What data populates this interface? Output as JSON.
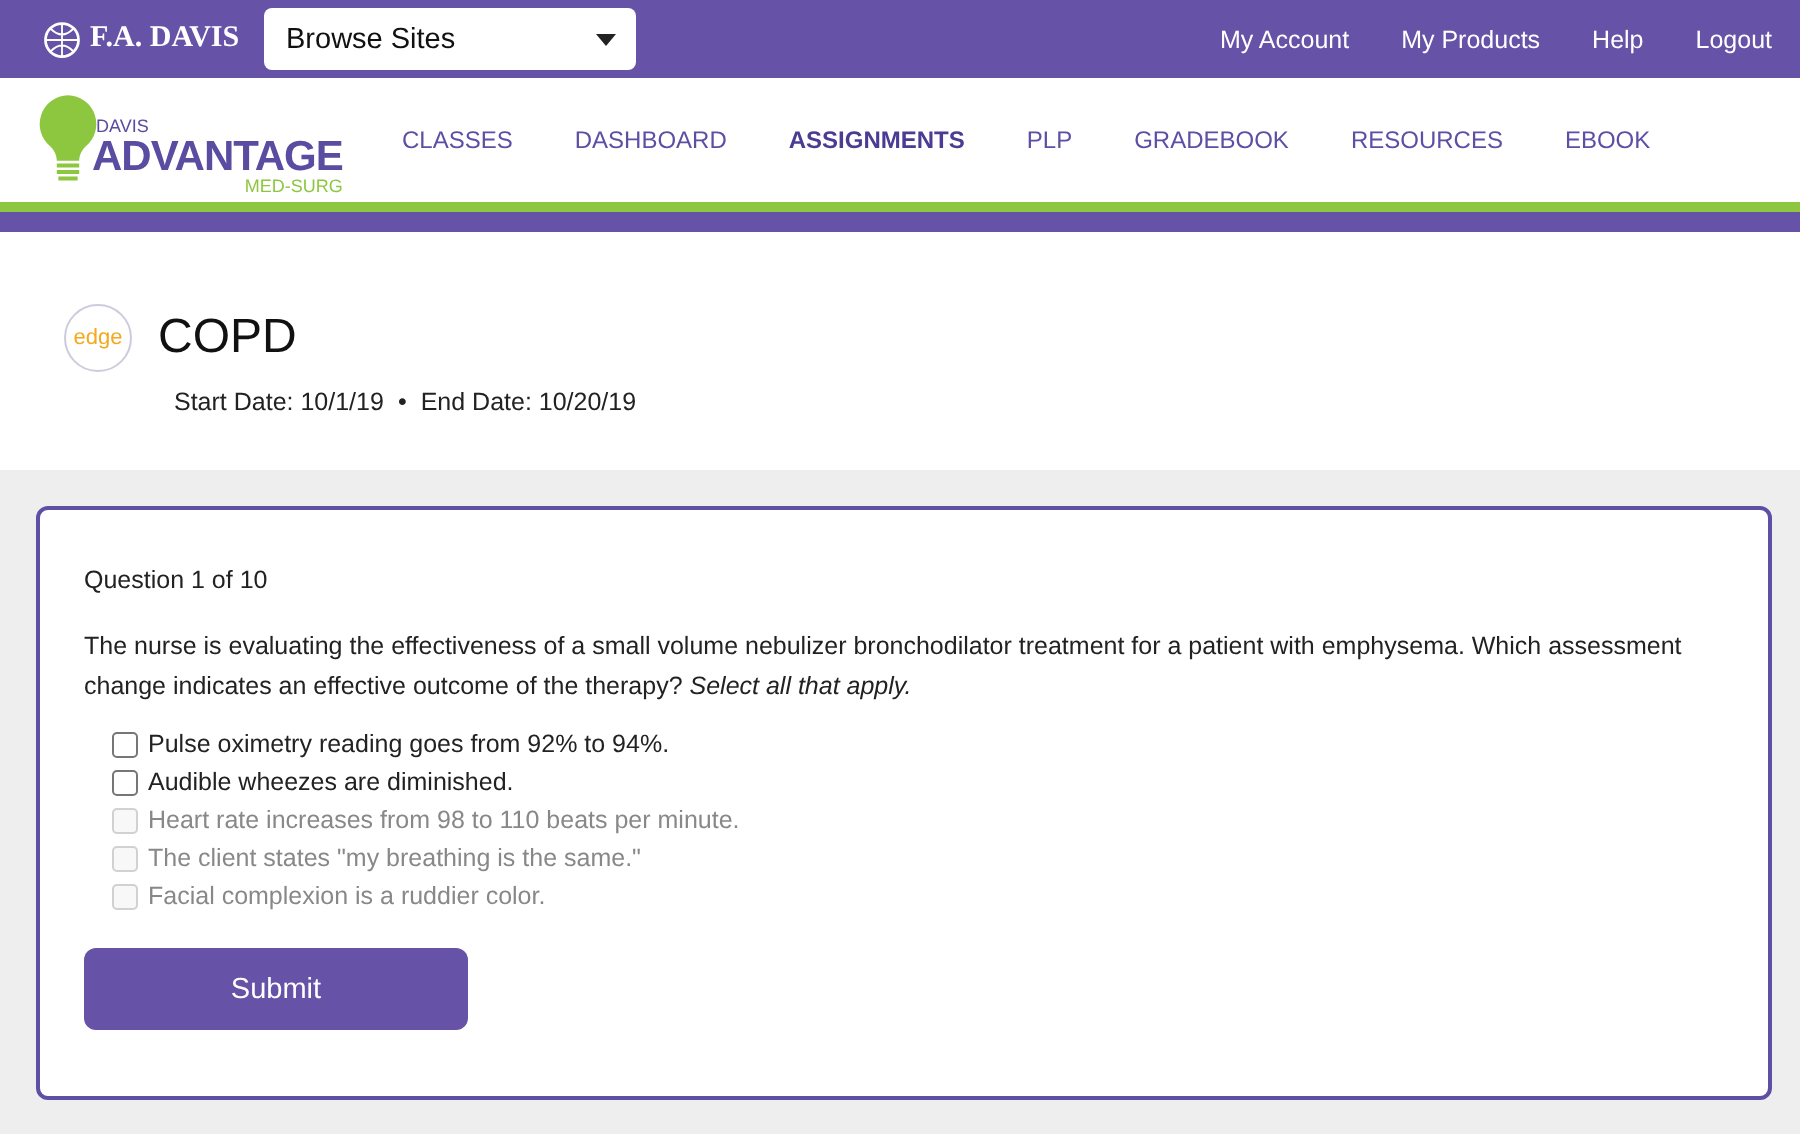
{
  "top_bar": {
    "brand": "F.A. DAVIS",
    "site_select": {
      "value": "Browse Sites"
    },
    "links": [
      "My Account",
      "My Products",
      "Help",
      "Logout"
    ]
  },
  "product_logo": {
    "small": "DAVIS",
    "main": "ADVANTAGE",
    "sub": "MED-SURG"
  },
  "nav_tabs": [
    {
      "label": "CLASSES",
      "selected": false
    },
    {
      "label": "DASHBOARD",
      "selected": false
    },
    {
      "label": "ASSIGNMENTS",
      "selected": true
    },
    {
      "label": "PLP",
      "selected": false
    },
    {
      "label": "GRADEBOOK",
      "selected": false
    },
    {
      "label": "RESOURCES",
      "selected": false
    },
    {
      "label": "EBOOK",
      "selected": false
    }
  ],
  "assignment": {
    "badge": "edge",
    "title": "COPD",
    "start_date": "Start Date: 10/1/19",
    "separator": "•",
    "end_date": "End Date: 10/20/19"
  },
  "question": {
    "counter": "Question 1 of 10",
    "prompt": "The nurse is evaluating the effectiveness of a small volume nebulizer bronchodilator treatment for a patient with emphysema. Which assessment change indicates an effective outcome of the therapy? *Select all that apply.*",
    "options": [
      {
        "label": "Pulse oximetry reading goes from 92% to 94%.",
        "checked": false,
        "disabled": false
      },
      {
        "label": "Audible wheezes are diminished.",
        "checked": false,
        "disabled": false
      },
      {
        "label": "Heart rate increases from 98 to 110 beats per minute.",
        "checked": false,
        "disabled": true
      },
      {
        "label": "The client states \"my breathing is the same.\"",
        "checked": false,
        "disabled": true
      },
      {
        "label": "Facial complexion is a ruddier color.",
        "checked": false,
        "disabled": true
      }
    ],
    "submit": "Submit"
  }
}
